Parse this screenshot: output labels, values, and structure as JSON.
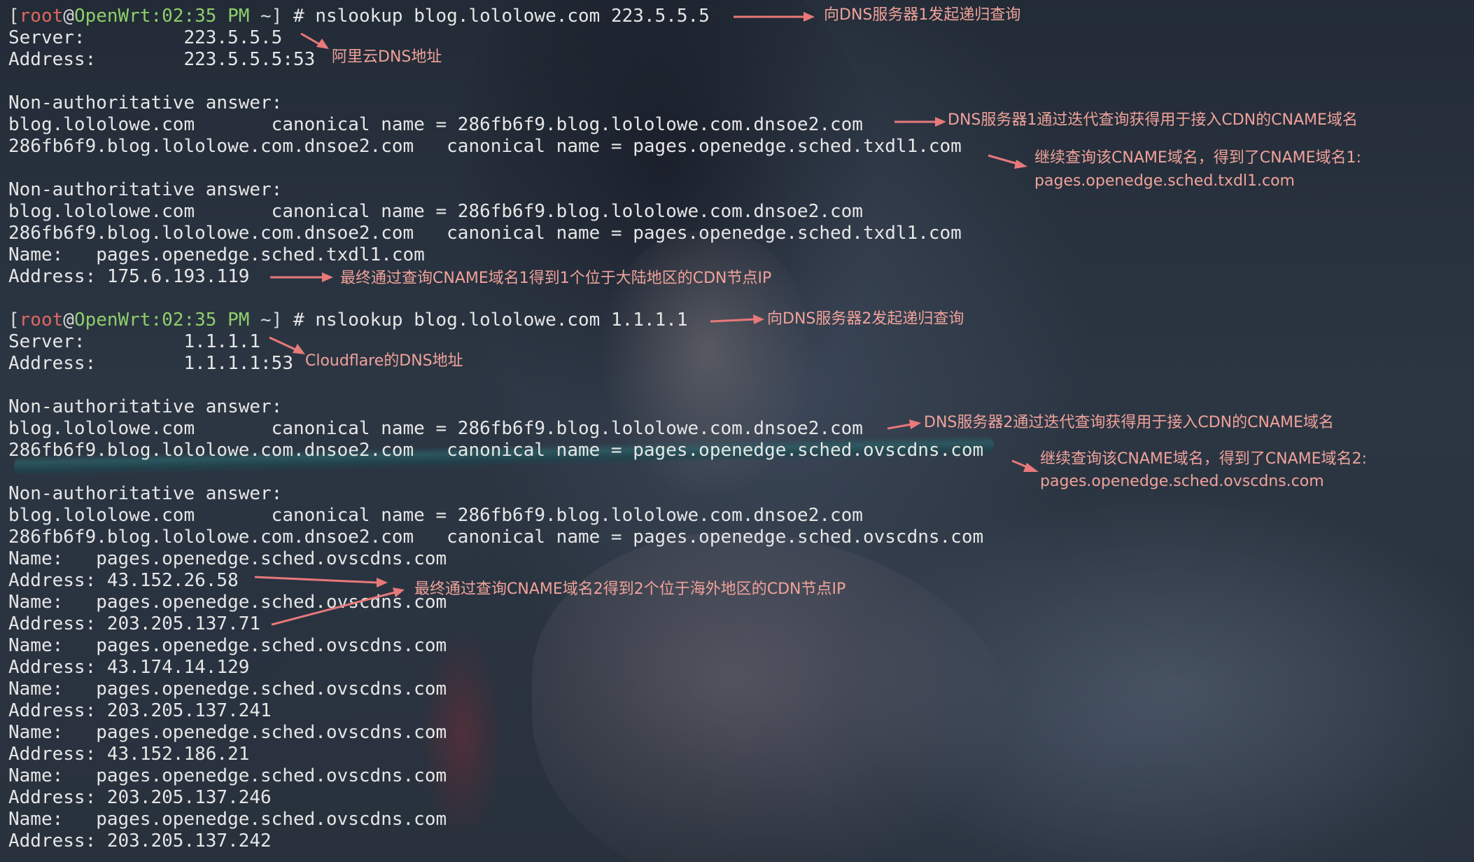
{
  "terminal": {
    "prompt": {
      "bracket_open": "[",
      "user": "root",
      "at": "@",
      "host": "OpenWrt",
      "time": ":02:35 PM",
      "cwd": " ~]",
      "symbol": " # "
    },
    "lines": [
      {
        "kind": "prompt",
        "cmd": "nslookup blog.lololowe.com 223.5.5.5"
      },
      {
        "text": "Server:         223.5.5.5"
      },
      {
        "text": "Address:        223.5.5.5:53"
      },
      {
        "text": ""
      },
      {
        "text": "Non-authoritative answer:"
      },
      {
        "text": "blog.lololowe.com       canonical name = 286fb6f9.blog.lololowe.com.dnsoe2.com"
      },
      {
        "text": "286fb6f9.blog.lololowe.com.dnsoe2.com   canonical name = pages.openedge.sched.txdl1.com"
      },
      {
        "text": ""
      },
      {
        "text": "Non-authoritative answer:"
      },
      {
        "text": "blog.lololowe.com       canonical name = 286fb6f9.blog.lololowe.com.dnsoe2.com"
      },
      {
        "text": "286fb6f9.blog.lololowe.com.dnsoe2.com   canonical name = pages.openedge.sched.txdl1.com"
      },
      {
        "text": "Name:   pages.openedge.sched.txdl1.com"
      },
      {
        "text": "Address: 175.6.193.119"
      },
      {
        "text": ""
      },
      {
        "kind": "prompt",
        "cmd": "nslookup blog.lololowe.com 1.1.1.1"
      },
      {
        "text": "Server:         1.1.1.1"
      },
      {
        "text": "Address:        1.1.1.1:53"
      },
      {
        "text": ""
      },
      {
        "text": "Non-authoritative answer:"
      },
      {
        "text": "blog.lololowe.com       canonical name = 286fb6f9.blog.lololowe.com.dnsoe2.com"
      },
      {
        "text": "286fb6f9.blog.lololowe.com.dnsoe2.com   canonical name = pages.openedge.sched.ovscdns.com"
      },
      {
        "text": ""
      },
      {
        "text": "Non-authoritative answer:"
      },
      {
        "text": "blog.lololowe.com       canonical name = 286fb6f9.blog.lololowe.com.dnsoe2.com"
      },
      {
        "text": "286fb6f9.blog.lololowe.com.dnsoe2.com   canonical name = pages.openedge.sched.ovscdns.com"
      },
      {
        "text": "Name:   pages.openedge.sched.ovscdns.com"
      },
      {
        "text": "Address: 43.152.26.58"
      },
      {
        "text": "Name:   pages.openedge.sched.ovscdns.com"
      },
      {
        "text": "Address: 203.205.137.71"
      },
      {
        "text": "Name:   pages.openedge.sched.ovscdns.com"
      },
      {
        "text": "Address: 43.174.14.129"
      },
      {
        "text": "Name:   pages.openedge.sched.ovscdns.com"
      },
      {
        "text": "Address: 203.205.137.241"
      },
      {
        "text": "Name:   pages.openedge.sched.ovscdns.com"
      },
      {
        "text": "Address: 43.152.186.21"
      },
      {
        "text": "Name:   pages.openedge.sched.ovscdns.com"
      },
      {
        "text": "Address: 203.205.137.246"
      },
      {
        "text": "Name:   pages.openedge.sched.ovscdns.com"
      },
      {
        "text": "Address: 203.205.137.242"
      }
    ]
  },
  "annotations": {
    "recursive_query_1": "向DNS服务器1发起递归查询",
    "aliyun_dns": "阿里云DNS地址",
    "cname_via_server1": "DNS服务器1通过迭代查询获得用于接入CDN的CNAME域名",
    "continue_cname_1": "继续查询该CNAME域名，得到了CNAME域名1:",
    "cname_1_domain": "pages.openedge.sched.txdl1.com",
    "final_ip_1": "最终通过查询CNAME域名1得到1个位于大陆地区的CDN节点IP",
    "recursive_query_2": "向DNS服务器2发起递归查询",
    "cloudflare_dns": "Cloudflare的DNS地址",
    "cname_via_server2": "DNS服务器2通过迭代查询获得用于接入CDN的CNAME域名",
    "continue_cname_2": "继续查询该CNAME域名，得到了CNAME域名2:",
    "cname_2_domain": "pages.openedge.sched.ovscdns.com",
    "final_ip_2": "最终通过查询CNAME域名2得到2个位于海外地区的CDN节点IP"
  },
  "colors": {
    "annotation": "#f0a29a",
    "arrow": "#e8797a",
    "prompt_user": "#e0675f",
    "prompt_host": "#8fcf6a",
    "terminal_text": "#e6e6e6"
  }
}
